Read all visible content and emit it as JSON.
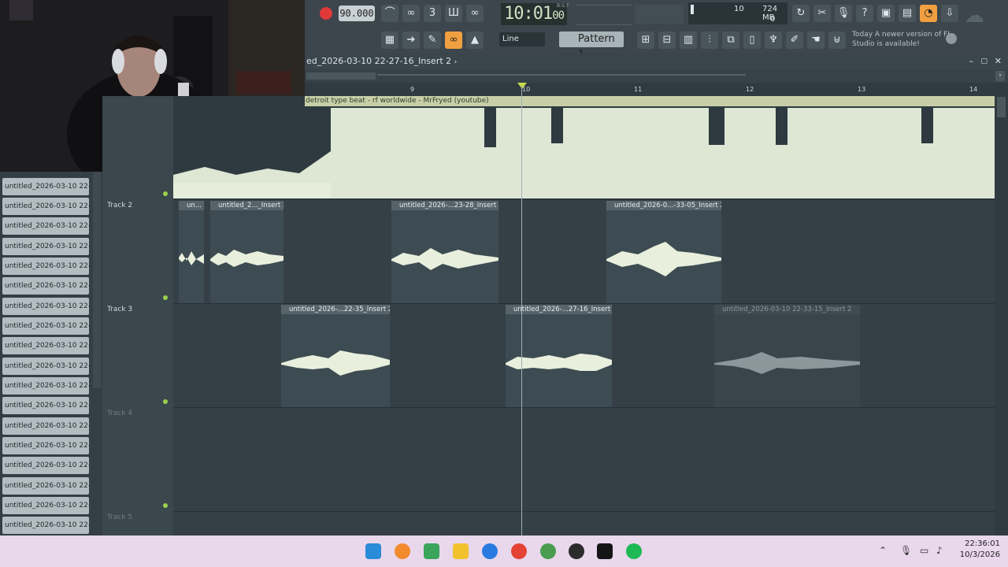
{
  "toolbar": {
    "tempo": "90.000",
    "time": "10:01",
    "time_sub": "00",
    "time_label": "B:S:T",
    "snap": "Line",
    "pattern": "Pattern 1",
    "cpu_voices": "10",
    "memory": "724 MB",
    "polyphony": "0",
    "news_label": "Today",
    "news_text": "A newer version of FL Studio is available!"
  },
  "playlist": {
    "title": "ed_2026-03-10 22-27-16_Insert 2",
    "ruler": [
      "9",
      "10",
      "11",
      "12",
      "13",
      "14"
    ],
    "big_clip_title": "detroit type beat - rf worldwide - MrFryed (youtube)"
  },
  "picker": {
    "items": [
      "untitled_2026-03-10 22-...",
      "untitled_2026-03-10 22-...",
      "untitled_2026-03-10 22-...",
      "untitled_2026-03-10 22-...",
      "untitled_2026-03-10 22-...",
      "untitled_2026-03-10 22-...",
      "untitled_2026-03-10 22-...",
      "untitled_2026-03-10 22-...",
      "untitled_2026-03-10 22-...",
      "untitled_2026-03-10 22-...",
      "untitled_2026-03-10 22-...",
      "untitled_2026-03-10 22-...",
      "untitled_2026-03-10 22-...",
      "untitled_2026-03-10 22-...",
      "untitled_2026-03-10 22-...",
      "untitled_2026-03-10 22-...",
      "untitled_2026-03-10 22-...",
      "untitled_2026-03-10 22-..."
    ]
  },
  "tracks": {
    "track2": "Track 2",
    "track3": "Track 3",
    "track4": "Track 4",
    "track5": "Track 5"
  },
  "clips": {
    "t2a": "un...",
    "t2b": "untitled_2..._Insert 2",
    "t2c": "untitled_2026-...23-28_Insert 2",
    "t2d": "untitled_2026-0...-33-05_Insert 2",
    "t3a": "untitled_2026-...22-35_Insert 2",
    "t3b": "untitled_2026-...27-16_Insert 2",
    "t3c": "untitled_2026-03-10 22-33-15_Insert 2"
  },
  "taskbar": {
    "time": "22:36:01",
    "date": "10/3/2026"
  },
  "colors": {
    "accent": "#f0a040",
    "record": "#e0393a",
    "wave": "#e8efdc"
  }
}
